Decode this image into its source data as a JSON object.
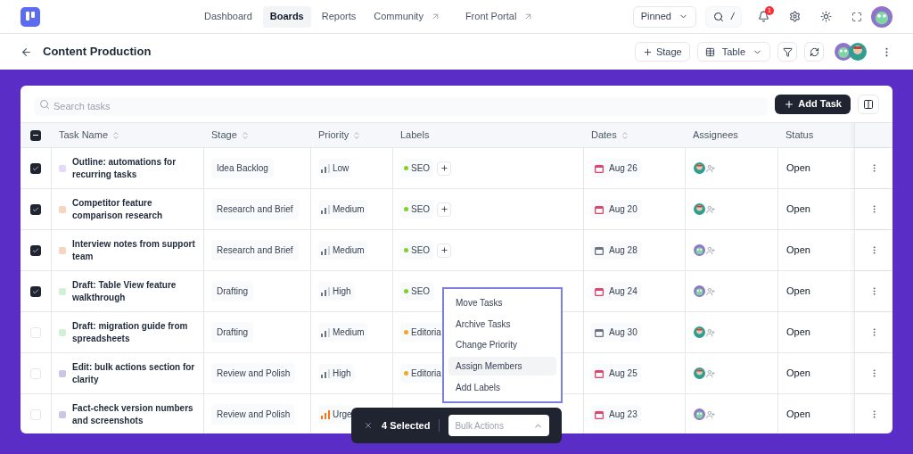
{
  "nav": {
    "tabs": [
      {
        "label": "Dashboard",
        "selected": false,
        "external": false
      },
      {
        "label": "Boards",
        "selected": true,
        "external": false
      },
      {
        "label": "Reports",
        "selected": false,
        "external": false
      },
      {
        "label": "Community",
        "selected": false,
        "external": true
      },
      {
        "label": "Front Portal",
        "selected": false,
        "external": true
      }
    ],
    "pinned": "Pinned",
    "shortcut": "/",
    "notifications": "1"
  },
  "board": {
    "title": "Content Production",
    "stage_button": "Stage",
    "view": "Table"
  },
  "search": {
    "placeholder": "Search tasks"
  },
  "add_task": "Add Task",
  "table": {
    "select_all_partial": true,
    "columns": [
      {
        "label": "Task Name",
        "sortable": true
      },
      {
        "label": "Stage",
        "sortable": true
      },
      {
        "label": "Priority",
        "sortable": true
      },
      {
        "label": "Labels",
        "sortable": false
      },
      {
        "label": "Dates",
        "sortable": true
      },
      {
        "label": "Assignees",
        "sortable": false
      },
      {
        "label": "Status",
        "sortable": false
      }
    ],
    "rows": [
      {
        "checked": true,
        "color": "#e4d9f7",
        "name": "Outline: automations for recurring tasks",
        "stage": "Idea Backlog",
        "priority": {
          "text": "Low",
          "urgent": false
        },
        "labels": [
          {
            "text": "SEO",
            "color": "#7ed321"
          }
        ],
        "add_label": true,
        "date": {
          "text": "Aug 26",
          "color": "#e0446a"
        },
        "assignees": [
          {
            "kind": "person"
          }
        ],
        "status": "Open"
      },
      {
        "checked": true,
        "color": "#f6d5c1",
        "name": "Competitor feature comparison research",
        "stage": "Research and Brief",
        "priority": {
          "text": "Medium",
          "urgent": false
        },
        "labels": [
          {
            "text": "SEO",
            "color": "#7ed321"
          }
        ],
        "add_label": true,
        "date": {
          "text": "Aug 20",
          "color": "#e0446a"
        },
        "assignees": [
          {
            "kind": "person"
          }
        ],
        "status": "Open"
      },
      {
        "checked": true,
        "color": "#f6d5c1",
        "name": "Interview notes from support team",
        "stage": "Research and Brief",
        "priority": {
          "text": "Medium",
          "urgent": false
        },
        "labels": [
          {
            "text": "SEO",
            "color": "#7ed321"
          }
        ],
        "add_label": true,
        "date": {
          "text": "Aug 28",
          "color": "#6b7280"
        },
        "assignees": [
          {
            "kind": "mascot"
          }
        ],
        "status": "Open"
      },
      {
        "checked": true,
        "color": "#d3f0d6",
        "name": "Draft: Table View feature walkthrough",
        "stage": "Drafting",
        "priority": {
          "text": "High",
          "urgent": false
        },
        "labels": [
          {
            "text": "SEO",
            "color": "#7ed321"
          }
        ],
        "add_label": false,
        "date": {
          "text": "Aug 24",
          "color": "#e0446a"
        },
        "assignees": [
          {
            "kind": "mascot"
          }
        ],
        "status": "Open"
      },
      {
        "checked": false,
        "color": "#d3f0d6",
        "name": "Draft: migration guide from spreadsheets",
        "stage": "Drafting",
        "priority": {
          "text": "Medium",
          "urgent": false
        },
        "labels": [
          {
            "text": "Editoria",
            "color": "#f5a623"
          }
        ],
        "add_label": false,
        "date": {
          "text": "Aug 30",
          "color": "#6b7280"
        },
        "assignees": [
          {
            "kind": "person"
          }
        ],
        "status": "Open"
      },
      {
        "checked": false,
        "color": "#c9c6e6",
        "name": "Edit: bulk actions section for clarity",
        "stage": "Review and Polish",
        "priority": {
          "text": "High",
          "urgent": false
        },
        "labels": [
          {
            "text": "Editoria",
            "color": "#f5a623"
          }
        ],
        "add_label": false,
        "date": {
          "text": "Aug 25",
          "color": "#e0446a"
        },
        "assignees": [
          {
            "kind": "person"
          }
        ],
        "status": "Open"
      },
      {
        "checked": false,
        "color": "#c9c6e6",
        "name": "Fact-check version numbers and screenshots",
        "stage": "Review and Polish",
        "priority": {
          "text": "Urge",
          "urgent": true
        },
        "add_label": false,
        "date": {
          "text": "Aug 23",
          "color": "#e0446a"
        },
        "assignees": [
          {
            "kind": "mascot"
          }
        ],
        "status": "Open"
      }
    ]
  },
  "bulk_menu": {
    "items": [
      {
        "label": "Move Tasks",
        "selected": false
      },
      {
        "label": "Archive Tasks",
        "selected": false
      },
      {
        "label": "Change Priority",
        "selected": false
      },
      {
        "label": "Assign Members",
        "selected": true
      },
      {
        "label": "Add Labels",
        "selected": false
      }
    ]
  },
  "bulk_bar": {
    "count": "4 Selected",
    "placeholder": "Bulk Actions"
  }
}
